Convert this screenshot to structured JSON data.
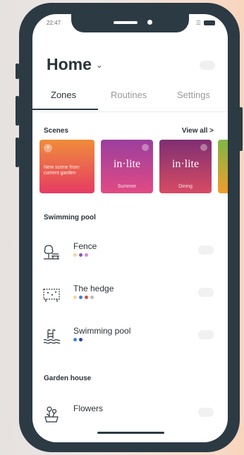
{
  "status": {
    "time": "22:47",
    "wifi_icon": "wifi-icon",
    "battery_icon": "battery-icon"
  },
  "header": {
    "title": "Home",
    "dropdown_icon": "chevron-down-icon"
  },
  "tabs": [
    {
      "label": "Zones",
      "active": true
    },
    {
      "label": "Routines",
      "active": false
    },
    {
      "label": "Settings",
      "active": false
    }
  ],
  "scenes": {
    "title": "Scenes",
    "view_all": "View all >",
    "items": [
      {
        "type": "new",
        "label": "New scene from current garden",
        "color_top": "#ef8d3a",
        "color_bottom": "#e63b63"
      },
      {
        "type": "scene",
        "brand": "in·lite",
        "name": "Summer",
        "color_top": "#9a3f9e",
        "color_bottom": "#e24a84"
      },
      {
        "type": "scene",
        "brand": "in·lite",
        "name": "Dining",
        "color_top": "#7e2f73",
        "color_bottom": "#d84b63"
      },
      {
        "type": "partial",
        "color_top": "#7fb646",
        "color_bottom": "#f29d2b"
      }
    ]
  },
  "sections": [
    {
      "title": "Swimming pool",
      "zones": [
        {
          "name": "Fence",
          "icon": "tree-bench-icon",
          "dots": [
            "#f5d3a6",
            "#7a5bc2",
            "#d98ad6"
          ]
        },
        {
          "name": "The hedge",
          "icon": "hedge-icon",
          "dots": [
            "#f5d3a6",
            "#3b82d6",
            "#e54a3b",
            "#bbbbbb"
          ]
        },
        {
          "name": "Swimming pool",
          "icon": "pool-ladder-icon",
          "dots": [
            "#3b82d6",
            "#273f9c"
          ]
        }
      ]
    },
    {
      "title": "Garden house",
      "zones": [
        {
          "name": "Flowers",
          "icon": "flowers-icon",
          "dots": []
        }
      ]
    }
  ]
}
